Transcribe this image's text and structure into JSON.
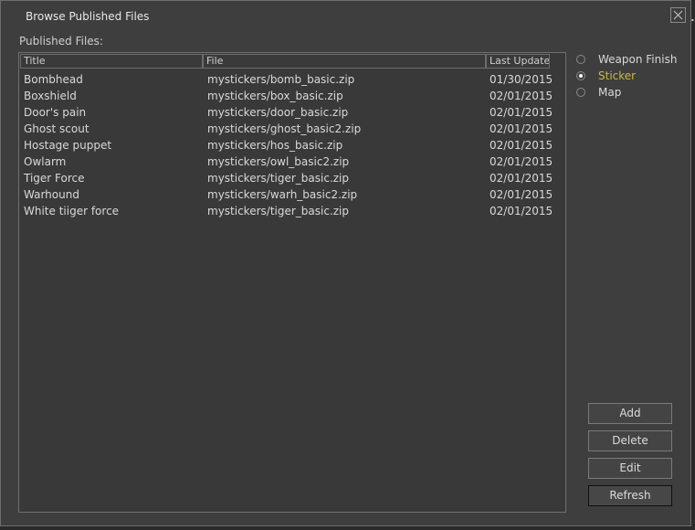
{
  "window": {
    "title": "Browse Published Files",
    "edge_glyph": "⬝"
  },
  "files_label": "Published Files:",
  "columns": {
    "title": "Title",
    "file": "File",
    "last_updated": "Last Updated"
  },
  "rows": [
    {
      "title": "Bombhead",
      "file": "mystickers/bomb_basic.zip",
      "date": "01/30/2015"
    },
    {
      "title": "Boxshield",
      "file": "mystickers/box_basic.zip",
      "date": "02/01/2015"
    },
    {
      "title": "Door's pain",
      "file": "mystickers/door_basic.zip",
      "date": "02/01/2015"
    },
    {
      "title": "Ghost scout",
      "file": "mystickers/ghost_basic2.zip",
      "date": "02/01/2015"
    },
    {
      "title": "Hostage puppet",
      "file": "mystickers/hos_basic.zip",
      "date": "02/01/2015"
    },
    {
      "title": "Owlarm",
      "file": "mystickers/owl_basic2.zip",
      "date": "02/01/2015"
    },
    {
      "title": "Tiger Force",
      "file": "mystickers/tiger_basic.zip",
      "date": "02/01/2015"
    },
    {
      "title": "Warhound",
      "file": "mystickers/warh_basic2.zip",
      "date": "02/01/2015"
    },
    {
      "title": "White tiiger force",
      "file": "mystickers/tiger_basic.zip",
      "date": "02/01/2015"
    }
  ],
  "type_filter": {
    "options": [
      "Weapon Finish",
      "Sticker",
      "Map"
    ],
    "selected": "Sticker"
  },
  "buttons": {
    "add": "Add",
    "delete": "Delete",
    "edit": "Edit",
    "refresh": "Refresh"
  },
  "colors": {
    "selected_option": "#c8b84a",
    "window_bg": "#3e3e3e"
  },
  "icons": {
    "close": "close-icon"
  }
}
